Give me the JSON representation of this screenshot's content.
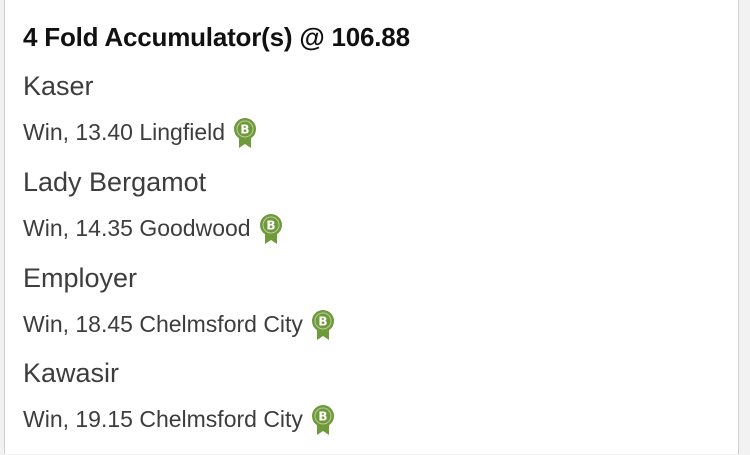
{
  "bet": {
    "title": "4 Fold Accumulator(s) @ 106.88"
  },
  "selections": [
    {
      "horse": "Kaser",
      "market": "Win, 13.40 Lingfield",
      "badge": "B"
    },
    {
      "horse": "Lady Bergamot",
      "market": "Win, 14.35 Goodwood",
      "badge": "B"
    },
    {
      "horse": "Employer",
      "market": "Win, 18.45 Chelmsford City",
      "badge": "B"
    },
    {
      "horse": "Kawasir",
      "market": "Win, 19.15 Chelmsford City",
      "badge": "B"
    }
  ],
  "colors": {
    "badge": "#6f9a3a",
    "text": "#3d3d3d",
    "title": "#111111"
  }
}
